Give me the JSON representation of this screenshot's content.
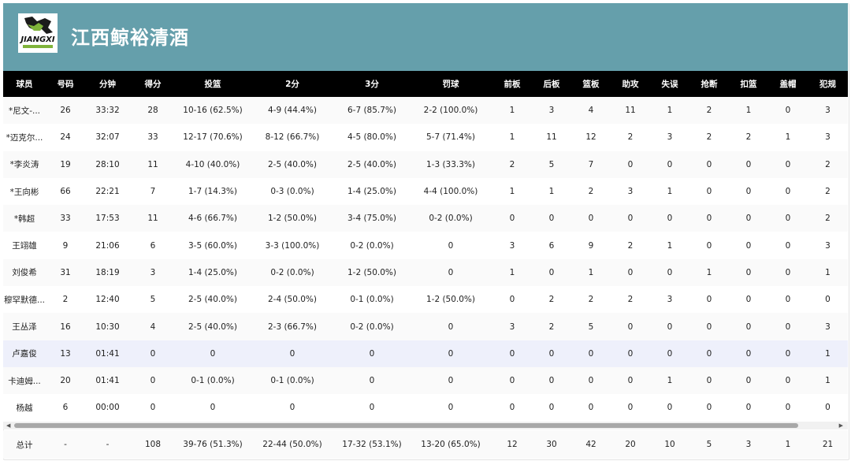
{
  "team": {
    "name": "江西鲸裕清酒",
    "logo_text": "JIANGXI"
  },
  "colors": {
    "header_bg": "#659fab",
    "table_header_bg": "#000000"
  },
  "columns": [
    "球员",
    "号码",
    "分钟",
    "得分",
    "投篮",
    "2分",
    "3分",
    "罚球",
    "前板",
    "后板",
    "篮板",
    "助攻",
    "失误",
    "抢断",
    "扣篮",
    "盖帽",
    "犯规"
  ],
  "rows": [
    [
      "*尼文-...",
      "26",
      "33:32",
      "28",
      "10-16 (62.5%)",
      "4-9 (44.4%)",
      "6-7 (85.7%)",
      "2-2 (100.0%)",
      "1",
      "3",
      "4",
      "11",
      "1",
      "2",
      "1",
      "0",
      "3"
    ],
    [
      "*迈克尔...",
      "24",
      "32:07",
      "33",
      "12-17 (70.6%)",
      "8-12 (66.7%)",
      "4-5 (80.0%)",
      "5-7 (71.4%)",
      "1",
      "11",
      "12",
      "2",
      "3",
      "2",
      "2",
      "1",
      "3"
    ],
    [
      "*李炎涛",
      "19",
      "28:10",
      "11",
      "4-10 (40.0%)",
      "2-5 (40.0%)",
      "2-5 (40.0%)",
      "1-3 (33.3%)",
      "2",
      "5",
      "7",
      "0",
      "0",
      "0",
      "0",
      "0",
      "2"
    ],
    [
      "*王向彬",
      "66",
      "22:21",
      "7",
      "1-7 (14.3%)",
      "0-3 (0.0%)",
      "1-4 (25.0%)",
      "4-4 (100.0%)",
      "1",
      "1",
      "2",
      "3",
      "1",
      "0",
      "0",
      "0",
      "2"
    ],
    [
      "*韩超",
      "33",
      "17:53",
      "11",
      "4-6 (66.7%)",
      "1-2 (50.0%)",
      "3-4 (75.0%)",
      "0-2 (0.0%)",
      "0",
      "0",
      "0",
      "0",
      "0",
      "0",
      "0",
      "0",
      "2"
    ],
    [
      "王翊雄",
      "9",
      "21:06",
      "6",
      "3-5 (60.0%)",
      "3-3 (100.0%)",
      "0-2 (0.0%)",
      "0",
      "3",
      "6",
      "9",
      "2",
      "1",
      "0",
      "0",
      "0",
      "3"
    ],
    [
      "刘俊希",
      "31",
      "18:19",
      "3",
      "1-4 (25.0%)",
      "0-2 (0.0%)",
      "1-2 (50.0%)",
      "0",
      "1",
      "0",
      "1",
      "0",
      "0",
      "1",
      "0",
      "0",
      "1"
    ],
    [
      "穆罕默德...",
      "2",
      "12:40",
      "5",
      "2-5 (40.0%)",
      "2-4 (50.0%)",
      "0-1 (0.0%)",
      "1-2 (50.0%)",
      "0",
      "2",
      "2",
      "2",
      "3",
      "0",
      "0",
      "0",
      "0"
    ],
    [
      "王丛泽",
      "16",
      "10:30",
      "4",
      "2-5 (40.0%)",
      "2-3 (66.7%)",
      "0-2 (0.0%)",
      "0",
      "3",
      "2",
      "5",
      "0",
      "0",
      "0",
      "0",
      "0",
      "3"
    ],
    [
      "卢嘉俊",
      "13",
      "01:41",
      "0",
      "0",
      "0",
      "0",
      "0",
      "0",
      "0",
      "0",
      "0",
      "0",
      "0",
      "0",
      "0",
      "1"
    ],
    [
      "卡迪姆...",
      "20",
      "01:41",
      "0",
      "0-1 (0.0%)",
      "0-1 (0.0%)",
      "0",
      "0",
      "0",
      "0",
      "0",
      "0",
      "1",
      "0",
      "0",
      "0",
      "1"
    ],
    [
      "杨越",
      "6",
      "00:00",
      "0",
      "0",
      "0",
      "0",
      "0",
      "0",
      "0",
      "0",
      "0",
      "0",
      "0",
      "0",
      "0",
      "0"
    ]
  ],
  "totals": [
    "总计",
    "-",
    "-",
    "108",
    "39-76 (51.3%)",
    "22-44 (50.0%)",
    "17-32 (53.1%)",
    "13-20 (65.0%)",
    "12",
    "30",
    "42",
    "20",
    "10",
    "5",
    "3",
    "1",
    "21"
  ],
  "scrollbar": {
    "left_arrow": "◀",
    "right_arrow": "▶"
  }
}
